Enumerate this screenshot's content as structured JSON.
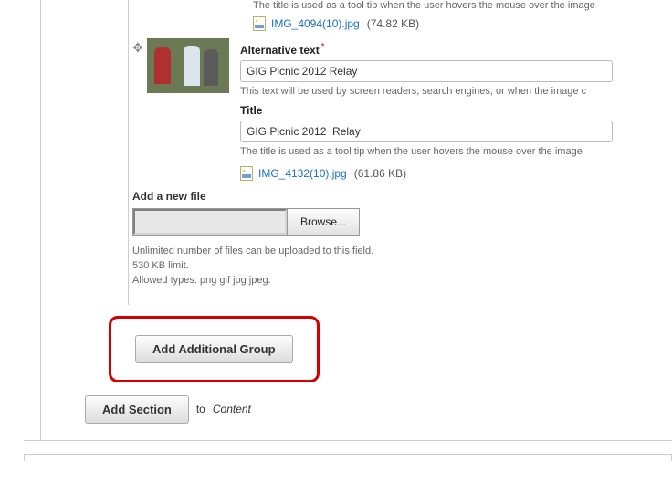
{
  "block1": {
    "title_help": "The title is used as a tool tip when the user hovers the mouse over the image",
    "file_name": "IMG_4094(10).jpg",
    "file_size": "(74.82 KB)"
  },
  "block2": {
    "alt_label": "Alternative text",
    "alt_value": "GIG Picnic 2012 Relay",
    "alt_help": "This text will be used by screen readers, search engines, or when the image c",
    "title_label": "Title",
    "title_value": "GIG Picnic 2012  Relay",
    "title_help": "The title is used as a tool tip when the user hovers the mouse over the image",
    "file_name": "IMG_4132(10).jpg",
    "file_size": "(61.86 KB)"
  },
  "upload": {
    "section_label": "Add a new file",
    "browse_label": "Browse...",
    "help_line1": "Unlimited number of files can be uploaded to this field.",
    "help_line2": "530 KB limit.",
    "help_line3": "Allowed types: png gif jpg jpeg."
  },
  "buttons": {
    "add_group": "Add Additional Group",
    "add_section": "Add Section",
    "to_word": "to",
    "content_word": "Content"
  }
}
